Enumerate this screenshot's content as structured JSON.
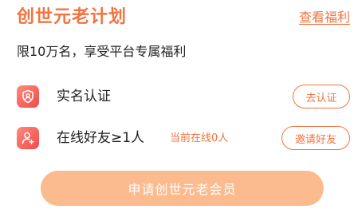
{
  "header": {
    "title": "创世元老计划",
    "benefits_link": "查看福利"
  },
  "subtitle": "限10万名，享受平台专属福利",
  "requirements": [
    {
      "icon": "shield-user-icon",
      "label": "实名认证",
      "status": "",
      "button": "去认证"
    },
    {
      "icon": "add-user-icon",
      "label": "在线好友≥1人",
      "status": "当前在线0人",
      "button": "邀请好友"
    }
  ],
  "apply_button": "申请创世元老会员",
  "colors": {
    "accent": "#f3733f",
    "icon_gradient_start": "#ff8a7a",
    "icon_gradient_end": "#ef4a4a",
    "apply_button_bg": "#fbbb8f"
  }
}
